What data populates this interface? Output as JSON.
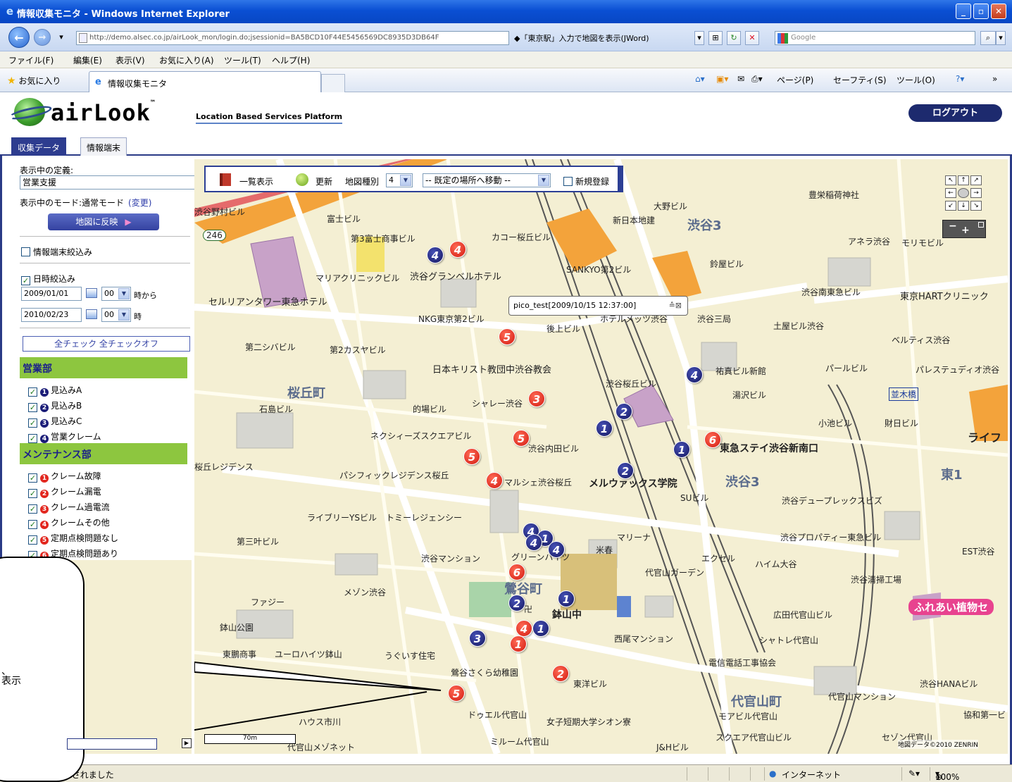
{
  "window": {
    "title": "情報収集モニタ - Windows Internet Explorer",
    "address": "http://demo.alsec.co.jp/airLook_mon/login.do;jsessionid=BA5BCD10F44E5456569DC8935D3DB64F",
    "address_hint": "◆「東京駅」入力で地図を表示(JWord)",
    "search_placeholder": "Google",
    "menu": [
      "ファイル(F)",
      "編集(E)",
      "表示(V)",
      "お気に入り(A)",
      "ツール(T)",
      "ヘルプ(H)"
    ],
    "favorites": "お気に入り",
    "tab_title": "情報収集モニタ",
    "commands": [
      "ページ(P)",
      "セーフティ(S)",
      "ツール(O)"
    ]
  },
  "app": {
    "logo": "airLook",
    "tm": "™",
    "tagline": "Location Based Services Platform",
    "logout": "ログアウト",
    "tabs": [
      "収集データ",
      "情報端末"
    ]
  },
  "sidebar": {
    "definition_label": "表示中の定義:",
    "definition_value": "営業支援",
    "mode_label": "表示中のモード:通常モード",
    "mode_change": "(変更)",
    "apply_button": "地図に反映",
    "terminal_filter": "情報端末絞込み",
    "date_filter": "日時絞込み",
    "from_date": "2009/01/01",
    "from_hour": "00",
    "from_suffix": "時から",
    "to_date": "2010/02/23",
    "to_hour": "00",
    "to_suffix": "時",
    "check_all": "全チェック",
    "uncheck_all": "全チェックオフ",
    "groups": [
      {
        "name": "営業部",
        "items": [
          {
            "num": "1",
            "label": "見込みA",
            "color": "blue"
          },
          {
            "num": "2",
            "label": "見込みB",
            "color": "blue"
          },
          {
            "num": "3",
            "label": "見込みC",
            "color": "blue"
          },
          {
            "num": "4",
            "label": "営業クレーム",
            "color": "blue"
          }
        ]
      },
      {
        "name": "メンテナンス部",
        "items": [
          {
            "num": "1",
            "label": "クレーム故障",
            "color": "red"
          },
          {
            "num": "2",
            "label": "クレーム漏電",
            "color": "red"
          },
          {
            "num": "3",
            "label": "クレーム過電流",
            "color": "red"
          },
          {
            "num": "4",
            "label": "クレームその他",
            "color": "red"
          },
          {
            "num": "5",
            "label": "定期点検問題なし",
            "color": "red"
          },
          {
            "num": "6",
            "label": "定期点検問題あり",
            "color": "red"
          }
        ]
      }
    ]
  },
  "map_toolbar": {
    "list": "一覧表示",
    "refresh": "更新",
    "map_type_label": "地図種別",
    "map_type_value": "4",
    "move_select": "-- 既定の場所へ移動 --",
    "new_register": "新規登録"
  },
  "popup": {
    "text": "pico_test[2009/10/15 12:37:00]"
  },
  "map_labels": [
    {
      "t": "渋谷野村ビル"
    },
    {
      "t": "富士ビル"
    },
    {
      "t": "第3富士商事ビル"
    },
    {
      "t": "カコー桜丘ビル"
    },
    {
      "t": "マリアクリニックビル"
    },
    {
      "t": "渋谷グランベルホテル"
    },
    {
      "t": "セルリアンタワー東急ホテル"
    },
    {
      "t": "NKG東京第2ビル"
    },
    {
      "t": "第二シバビル"
    },
    {
      "t": "第2カスヤビル"
    },
    {
      "t": "日本キリスト教団中渋谷教会"
    },
    {
      "t": "桜丘町"
    },
    {
      "t": "石島ビル"
    },
    {
      "t": "的場ビル"
    },
    {
      "t": "シャレー渋谷"
    },
    {
      "t": "ネクシィーズスクエアビル"
    },
    {
      "t": "渋谷内田ビル"
    },
    {
      "t": "桜丘レジデンス"
    },
    {
      "t": "パシフィックレジデンス桜丘"
    },
    {
      "t": "マルシェ渋谷桜丘"
    },
    {
      "t": "メルウァックス学院"
    },
    {
      "t": "ライブリーYSビル"
    },
    {
      "t": "トミーレジェンシー"
    },
    {
      "t": "第三叶ビル"
    },
    {
      "t": "渋谷マンション"
    },
    {
      "t": "グリーンハイツ"
    },
    {
      "t": "鶯谷町"
    },
    {
      "t": "メゾン渋谷"
    },
    {
      "t": "ファジー"
    },
    {
      "t": "鉢山公園"
    },
    {
      "t": "東鵬商事"
    },
    {
      "t": "ユーロハイツ鉢山"
    },
    {
      "t": "うぐいす住宅"
    },
    {
      "t": "鶯谷さくら幼稚園"
    },
    {
      "t": "鉢山中"
    },
    {
      "t": "西尾マンション"
    },
    {
      "t": "東洋ビル"
    },
    {
      "t": "ハウス市川"
    },
    {
      "t": "ドゥエル代官山"
    },
    {
      "t": "女子短期大学シオン寮"
    },
    {
      "t": "ミルーム代官山"
    },
    {
      "t": "代官山メゾネット"
    },
    {
      "t": "代官山ガーデン"
    },
    {
      "t": "マリーナ"
    },
    {
      "t": "エクセル"
    },
    {
      "t": "ハイム大谷"
    },
    {
      "t": "渋谷桜丘ビル"
    },
    {
      "t": "SANKYO第2ビル"
    },
    {
      "t": "大野ビル"
    },
    {
      "t": "新日本地建"
    },
    {
      "t": "渋谷3"
    },
    {
      "t": "豊栄稲荷神社"
    },
    {
      "t": "アネラ渋谷"
    },
    {
      "t": "モリモビル"
    },
    {
      "t": "鈴屋ビル"
    },
    {
      "t": "渋谷南東急ビル"
    },
    {
      "t": "東京HARTクリニック"
    },
    {
      "t": "ホテルメッツ渋谷"
    },
    {
      "t": "後上ビル"
    },
    {
      "t": "渋谷三局"
    },
    {
      "t": "土屋ビル渋谷"
    },
    {
      "t": "ベルティス渋谷"
    },
    {
      "t": "祐真ビル新館"
    },
    {
      "t": "パールビル"
    },
    {
      "t": "パレステュディオ渋谷"
    },
    {
      "t": "湯沢ビル"
    },
    {
      "t": "並木橋"
    },
    {
      "t": "小池ビル"
    },
    {
      "t": "財日ビル"
    },
    {
      "t": "ライフ"
    },
    {
      "t": "東急ステイ渋谷新南口"
    },
    {
      "t": "渋谷3"
    },
    {
      "t": "東1"
    },
    {
      "t": "渋谷デュープレックスビズ"
    },
    {
      "t": "SUビル"
    },
    {
      "t": "渋谷プロパティー東急ビル"
    },
    {
      "t": "EST渋谷"
    },
    {
      "t": "渋谷清掃工場"
    },
    {
      "t": "ふれあい植物セ"
    },
    {
      "t": "広田代官山ビル"
    },
    {
      "t": "シャトレ代官山"
    },
    {
      "t": "電信電話工事協会"
    },
    {
      "t": "渋谷HANAビル"
    },
    {
      "t": "代官山町"
    },
    {
      "t": "代官山マンション"
    },
    {
      "t": "モアビル代官山"
    },
    {
      "t": "協和第一ビ"
    },
    {
      "t": "スクエア代官山ビル"
    },
    {
      "t": "セゾン代官山"
    },
    {
      "t": "J&Hビル"
    },
    {
      "t": "246"
    },
    {
      "t": "卍"
    },
    {
      "t": "米春"
    }
  ],
  "markers": [
    {
      "n": "4",
      "c": "blue"
    },
    {
      "n": "4",
      "c": "red"
    },
    {
      "n": "5",
      "c": "red"
    },
    {
      "n": "3",
      "c": "red"
    },
    {
      "n": "5",
      "c": "red"
    },
    {
      "n": "5",
      "c": "red"
    },
    {
      "n": "4",
      "c": "red"
    },
    {
      "n": "2",
      "c": "blue"
    },
    {
      "n": "1",
      "c": "blue"
    },
    {
      "n": "1",
      "c": "blue"
    },
    {
      "n": "2",
      "c": "blue"
    },
    {
      "n": "6",
      "c": "red"
    },
    {
      "n": "4",
      "c": "blue"
    },
    {
      "n": "4",
      "c": "blue"
    },
    {
      "n": "1",
      "c": "blue"
    },
    {
      "n": "4",
      "c": "blue"
    },
    {
      "n": "4",
      "c": "blue"
    },
    {
      "n": "6",
      "c": "red"
    },
    {
      "n": "2",
      "c": "blue"
    },
    {
      "n": "1",
      "c": "blue"
    },
    {
      "n": "4",
      "c": "red"
    },
    {
      "n": "1",
      "c": "blue"
    },
    {
      "n": "1",
      "c": "red"
    },
    {
      "n": "3",
      "c": "blue"
    },
    {
      "n": "2",
      "c": "red"
    },
    {
      "n": "5",
      "c": "red"
    }
  ],
  "scale_label": "70m",
  "copyright": "地図データ©2010 ZENRIN",
  "callout_text": "、\n表示",
  "status": {
    "message": "ページが表示されました",
    "zone": "インターネット",
    "zoom": "100%"
  },
  "colors": {
    "accent": "#2a3a86",
    "group_header": "#8dc63f",
    "marker_red": "#e2261e",
    "marker_blue": "#1b1d78"
  }
}
